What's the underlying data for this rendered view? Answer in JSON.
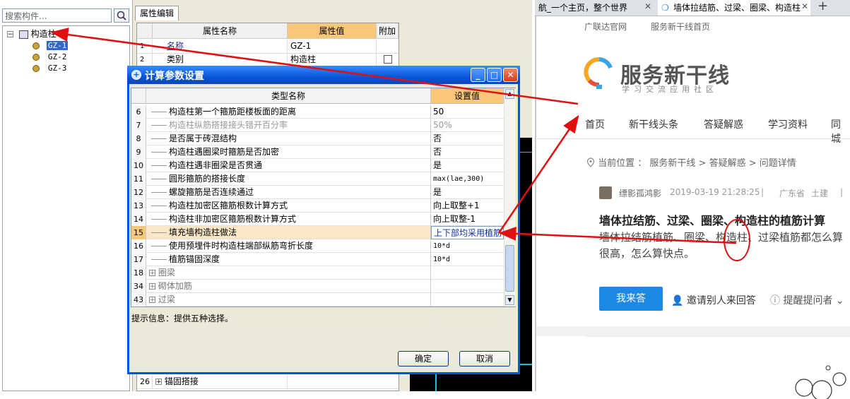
{
  "left": {
    "search_placeholder": "搜索构件...",
    "tree_root": "构造柱",
    "tree_items": [
      "GZ-1",
      "GZ-2",
      "GZ-3"
    ]
  },
  "prop": {
    "tab": "属性编辑",
    "headers": [
      "属性名称",
      "属性值",
      "附加"
    ],
    "rows": [
      {
        "num": "1",
        "name": "名称",
        "value": "GZ-1"
      },
      {
        "num": "2",
        "name": "类别",
        "value": "构造柱"
      }
    ],
    "bottom_row": {
      "num": "26",
      "name": "锚固搭接"
    }
  },
  "dialog": {
    "title": "计算参数设置",
    "headers": [
      "类型名称",
      "设置值"
    ],
    "rows": [
      {
        "num": "6",
        "name": "构造柱第一个箍筋距楼板面的距离",
        "value": "50"
      },
      {
        "num": "7",
        "name": "构造柱纵筋搭接接头错开百分率",
        "value": "50%",
        "dim": true
      },
      {
        "num": "8",
        "name": "是否属于砖混结构",
        "value": "否"
      },
      {
        "num": "9",
        "name": "构造柱遇圈梁时箍筋是否加密",
        "value": "否"
      },
      {
        "num": "10",
        "name": "构造柱遇非圈梁是否贯通",
        "value": "是"
      },
      {
        "num": "11",
        "name": "圆形箍筋的搭接长度",
        "value": "max(lae,300)",
        "mono": true
      },
      {
        "num": "12",
        "name": "螺旋箍筋是否连续通过",
        "value": "是"
      },
      {
        "num": "13",
        "name": "构造柱加密区箍筋根数计算方式",
        "value": "向上取整+1"
      },
      {
        "num": "14",
        "name": "构造柱非加密区箍筋根数计算方式",
        "value": "向上取整-1"
      },
      {
        "num": "15",
        "name": "填充墙构造柱做法",
        "value": "上下部均采用植筋",
        "selected": true
      },
      {
        "num": "16",
        "name": "使用预埋件时构造柱端部纵筋弯折长度",
        "value": "10*d",
        "mono": true
      },
      {
        "num": "17",
        "name": "植筋锚固深度",
        "value": "10*d",
        "mono": true
      }
    ],
    "groups": [
      {
        "num": "18",
        "name": "圈梁"
      },
      {
        "num": "34",
        "name": "砌体加筋"
      },
      {
        "num": "43",
        "name": "过梁"
      }
    ],
    "hint": "提示信息：提供五种选择。",
    "ok": "确定",
    "cancel": "取消"
  },
  "browser": {
    "tabs": [
      {
        "label": "航_一个主页，整个世界",
        "active": false
      },
      {
        "label": "墙体拉结筋、过梁、圈梁、构造柱",
        "active": true
      }
    ],
    "top_links": [
      "广联达官网",
      "服务新干线首页"
    ],
    "logo_title": "服务新干线",
    "logo_sub": "学习交流应用社区",
    "nav": [
      "首页",
      "新干线头条",
      "答疑解惑",
      "学习资料",
      "同城"
    ],
    "breadcrumb": "当前位置 ： 服务新干线 > 答疑解惑 > 问题详情",
    "question": {
      "user": "缥影孤鸿影",
      "time": "2019-03-19 21:28:25",
      "location": "广东省",
      "tag": "土建",
      "title": "墙体拉结筋、过梁、圈梁、构造柱的植筋计算",
      "body1": "墙体拉结筋植筋、圈梁、构造柱、过梁植筋都怎么算",
      "body2": "很高，怎么算快点。"
    },
    "answer_btn": "我来答",
    "invite": "邀请别人来回答",
    "remind": "提醒提问者",
    "colors": {
      "accent": "#1e88e5",
      "arrow": "#e01010"
    }
  }
}
